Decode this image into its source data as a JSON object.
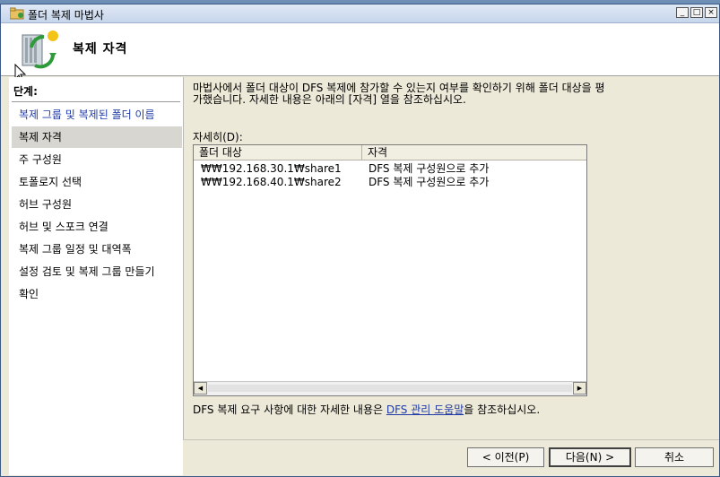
{
  "window": {
    "title": "폴더 복제 마법사",
    "minimize_glyph": "_",
    "maximize_glyph": "□",
    "close_glyph": "×"
  },
  "header": {
    "title": "복제 자격",
    "icon": "replication-wizard-icon"
  },
  "sidebar": {
    "heading": "단계:",
    "steps": [
      {
        "label": "복제 그룹 및 복제된 폴더 이름",
        "state": "link"
      },
      {
        "label": "복제 자격",
        "state": "current"
      },
      {
        "label": "주 구성원",
        "state": "normal"
      },
      {
        "label": "토폴로지 선택",
        "state": "normal"
      },
      {
        "label": "허브 구성원",
        "state": "normal"
      },
      {
        "label": "허브 및 스포크 연결",
        "state": "normal"
      },
      {
        "label": "복제 그룹 일정 및 대역폭",
        "state": "normal"
      },
      {
        "label": "설정 검토 및 복제 그룹 만들기",
        "state": "normal"
      },
      {
        "label": "확인",
        "state": "normal"
      }
    ]
  },
  "main": {
    "description": "마법사에서 폴더 대상이 DFS 복제에 참가할 수 있는지 여부를 확인하기 위해 폴더 대상을 평가했습니다. 자세한 내용은 아래의 [자격] 열을 참조하십시오.",
    "details_label": "자세히(D):",
    "columns": [
      "폴더 대상",
      "자격"
    ],
    "rows": [
      {
        "target": "₩₩192.168.30.1₩share1",
        "eligibility": "DFS 복제 구성원으로 추가"
      },
      {
        "target": "₩₩192.168.40.1₩share2",
        "eligibility": "DFS 복제 구성원으로 추가"
      }
    ],
    "footer_prefix": "DFS 복제 요구 사항에 대한 자세한 내용은 ",
    "footer_link": "DFS 관리 도움말",
    "footer_suffix": "을 참조하십시오."
  },
  "buttons": {
    "back": "< 이전(P)",
    "next": "다음(N) >",
    "cancel": "취소"
  },
  "colors": {
    "link": "#1f3aa6",
    "current_step_bg": "#d8d6d0",
    "window_bg": "#ece9d8"
  }
}
